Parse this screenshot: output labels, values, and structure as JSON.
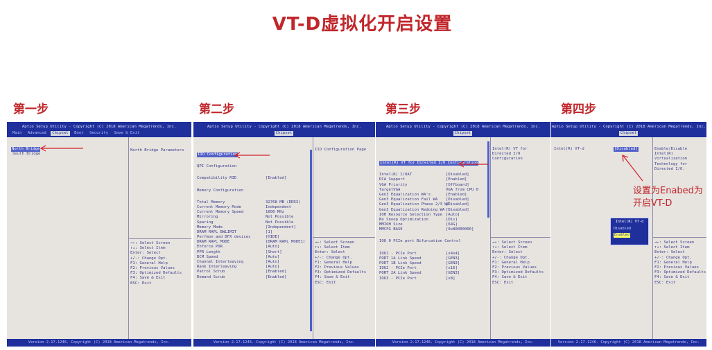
{
  "title": "VT-D虚拟化开启设置",
  "steps": [
    "第一步",
    "第二步",
    "第三步",
    "第四步"
  ],
  "bios": {
    "utility": "Aptio Setup Utility - Copyright (C) 2018 American Megatrends, Inc.",
    "footer": "Version 2.17.1246. Copyright (C) 2018 American Megatrends, Inc.",
    "tabs_full": [
      "Main",
      "Advanced",
      "Chipset",
      "Boot",
      "Security",
      "Save & Exit"
    ],
    "tab_chipset": "Chipset",
    "help_keys": [
      "→←: Select Screen",
      "↑↓: Select Item",
      "Enter: Select",
      "+/-: Change Opt.",
      "F1: General Help",
      "F2: Previous Values",
      "F3: Optimized Defaults",
      "F4: Save & Exit",
      "ESC: Exit"
    ]
  },
  "panel1": {
    "items": [
      "North Bridge",
      "South Bridge"
    ],
    "side_title": "North Bridge Parameters"
  },
  "panel2": {
    "side_title": "IIO Configuration Page",
    "rows": [
      {
        "label": "IIO Configuration",
        "value": ""
      },
      {
        "label": "QPI Configuration",
        "value": ""
      },
      {
        "label": "Compatibility RID",
        "value": "[Enabled]"
      },
      {
        "label": "Memory Configuration",
        "value": ""
      },
      {
        "label": "Total Memory",
        "value": "32768 MB (DDR3)"
      },
      {
        "label": "Current Memory Mode",
        "value": "Independent"
      },
      {
        "label": "Current Memory Speed",
        "value": "1600 MHz"
      },
      {
        "label": "Mirroring",
        "value": "Not Possible"
      },
      {
        "label": "Sparing",
        "value": "Not Possible"
      },
      {
        "label": "Memory Mode",
        "value": "[Independent]"
      },
      {
        "label": "DRAM RAPL BWLIMIT",
        "value": "[1]"
      },
      {
        "label": "Perfmon and DFX devices",
        "value": "[HIDE]"
      },
      {
        "label": "DRAM RAPL MODE",
        "value": "[DRAM RAPL MODE1]"
      },
      {
        "label": "Enforce POR",
        "value": "[Auto]"
      },
      {
        "label": "PPR Length",
        "value": "[Short]"
      },
      {
        "label": "DCM Speed",
        "value": "[Auto]"
      },
      {
        "label": "Channel Interleaving",
        "value": "[Auto]"
      },
      {
        "label": "Rank Interleaving",
        "value": "[Auto]"
      },
      {
        "label": "Patrol Scrub",
        "value": "[Enabled]"
      },
      {
        "label": "Demand Scrub",
        "value": "[Enabled]"
      }
    ]
  },
  "panel3": {
    "side_title": "Intel(R) VT for Directed I/O Configuration",
    "rows": [
      {
        "label": "Intel(R) VT for Directed I/O Configuration",
        "value": ""
      },
      {
        "label": "Intel(R) I/OAT",
        "value": "[Disabled]"
      },
      {
        "label": "DCA Support",
        "value": "[Enabled]"
      },
      {
        "label": "VGA Priority",
        "value": "[Offboard]"
      },
      {
        "label": "TargetVGA",
        "value": "VGA from CPU 0"
      },
      {
        "label": "Gen3 Equalization WA's",
        "value": "[Enabled]"
      },
      {
        "label": "Gen3 Equalization Fail WA",
        "value": "[Disabled]"
      },
      {
        "label": "Gen3 Equalization Phase 2/3 WA",
        "value": "[Disabled]"
      },
      {
        "label": "Gen3 Equalization Redoing WA",
        "value": "[Disabled]"
      },
      {
        "label": "IOH Resource Selection Type",
        "value": "[Auto]"
      },
      {
        "label": "No Snoop Optimization",
        "value": "[Dis]"
      },
      {
        "label": "MMIOH Size",
        "value": "[64G]"
      },
      {
        "label": "MMCFG BASE",
        "value": "[0x80000000]"
      },
      {
        "label": "IOU 0 PCIe port Bifurcation Control",
        "value": ""
      },
      {
        "label": "IOU1 - PCIe Port",
        "value": "[x4x4]"
      },
      {
        "label": "PORT 1A Link Speed",
        "value": "[GEN3]"
      },
      {
        "label": "PORT 1B Link Speed",
        "value": "[GEN3]"
      },
      {
        "label": "IOU2 - PCIe Port",
        "value": "[x16]"
      },
      {
        "label": "PORT 2A Link Speed",
        "value": "[GEN3]"
      },
      {
        "label": "IOU3 - PCIe Port",
        "value": "[x8]"
      }
    ]
  },
  "panel4": {
    "row_label": "Intel(R) VT-d",
    "row_value": "[Disabled]",
    "side_title": "Enable/Disable Intel(R) Virtualization Technology for Directed I/O.",
    "popup_title": "Intel(R) VT-d",
    "popup_options": [
      "Disabled",
      "Enabled"
    ],
    "annotation_line1": "设置为Enabed为",
    "annotation_line2": "开启VT-D"
  },
  "colors": {
    "accent": "#c0262a",
    "bios_blue": "#1f2f9c",
    "bios_bg": "#e7e4e0",
    "bios_text": "#3a3b8a",
    "highlight": "#5160c8"
  }
}
